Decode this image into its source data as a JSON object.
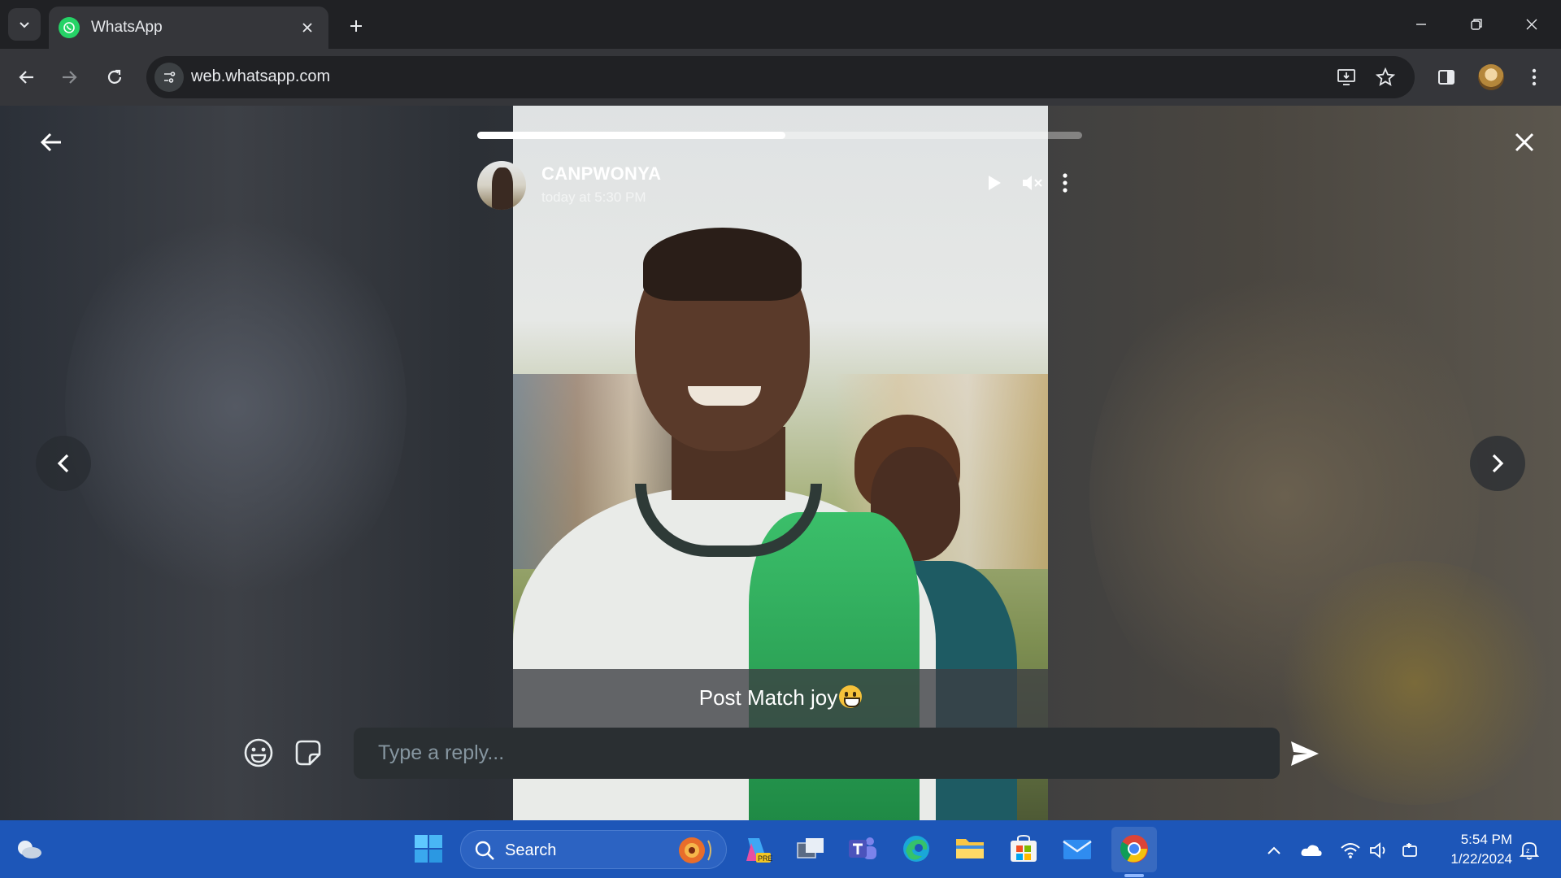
{
  "browser": {
    "tab_title": "WhatsApp",
    "url": "web.whatsapp.com",
    "icons": [
      "tab-search-icon",
      "whatsapp-favicon-icon",
      "close-tab-icon",
      "new-tab-icon",
      "minimize-icon",
      "restore-icon",
      "close-window-icon",
      "back-icon",
      "forward-icon",
      "reload-icon",
      "site-info-icon",
      "install-app-icon",
      "bookmark-star-icon",
      "side-panel-icon",
      "profile-avatar",
      "menu-icon"
    ]
  },
  "status": {
    "contact_name": "CANPWONYA",
    "timestamp": "today at 5:30 PM",
    "caption": "Post Match joy",
    "progress": 0.51,
    "reply_placeholder": "Type a reply..."
  },
  "taskbar": {
    "search_label": "Search",
    "time": "5:54 PM",
    "date": "1/22/2024",
    "apps": [
      "windows-start-icon",
      "copilot-icon",
      "task-view-icon",
      "teams-icon",
      "edge-icon",
      "file-explorer-icon",
      "microsoft-store-icon",
      "mail-icon",
      "chrome-icon"
    ]
  },
  "colors": {
    "chrome_bg": "#202124",
    "toolbar_bg": "#35363a",
    "whatsapp_green": "#25d366",
    "taskbar_blue": "#1d56b8"
  }
}
